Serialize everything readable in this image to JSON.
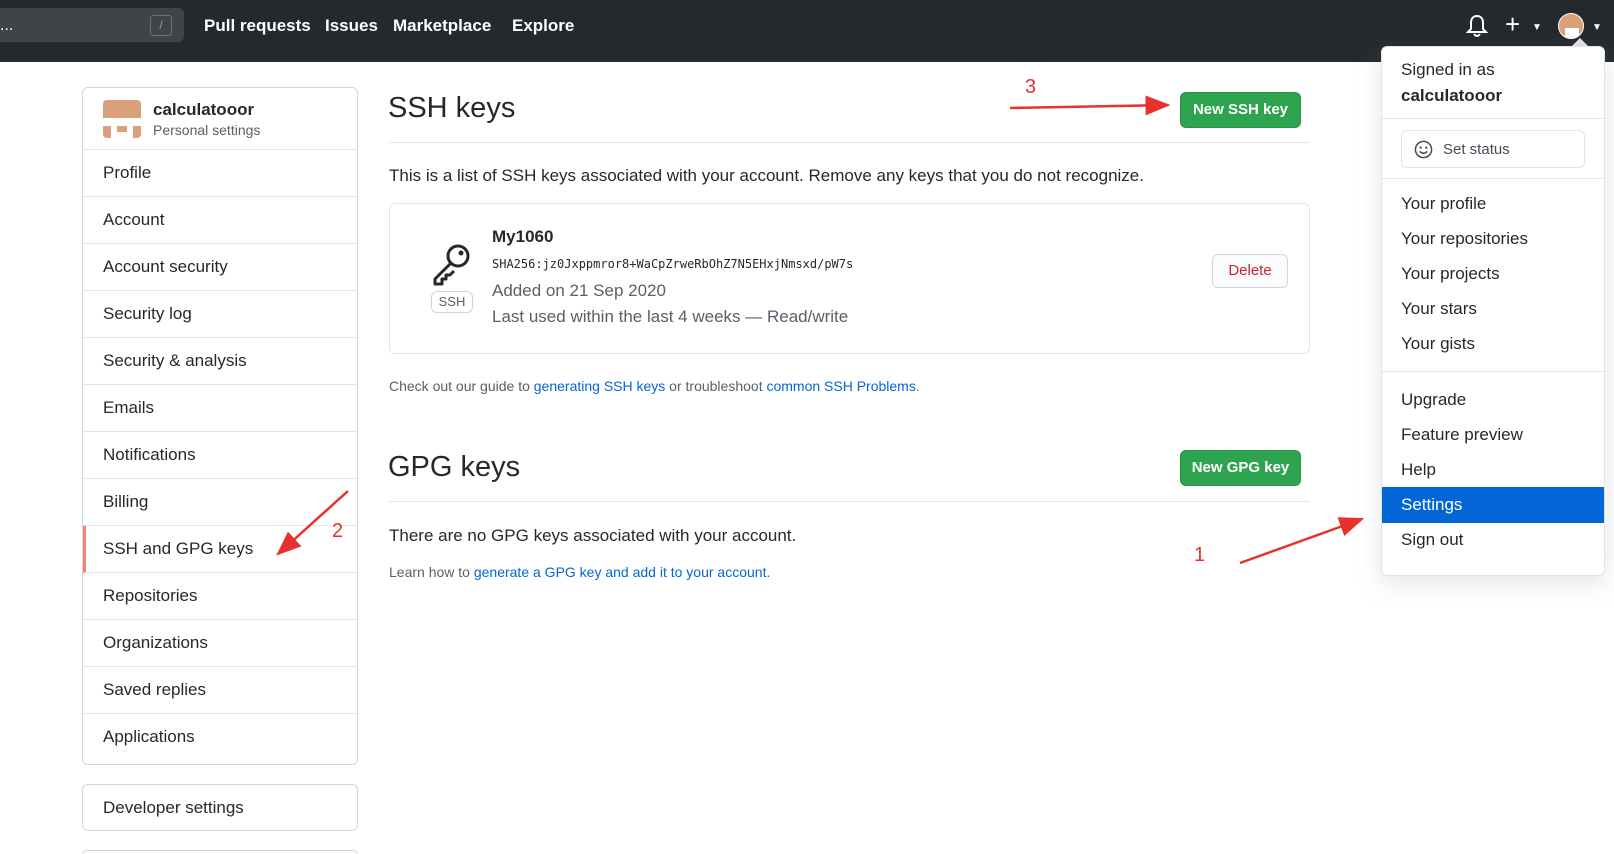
{
  "header": {
    "search_dots": "...",
    "search_shortcut": "/",
    "nav": [
      "Pull requests",
      "Issues",
      "Marketplace",
      "Explore"
    ],
    "plus": "+"
  },
  "sidebar": {
    "username": "calculatooor",
    "subtitle": "Personal settings",
    "items": [
      {
        "label": "Profile"
      },
      {
        "label": "Account"
      },
      {
        "label": "Account security"
      },
      {
        "label": "Security log"
      },
      {
        "label": "Security & analysis"
      },
      {
        "label": "Emails"
      },
      {
        "label": "Notifications"
      },
      {
        "label": "Billing"
      },
      {
        "label": "SSH and GPG keys",
        "active": true
      },
      {
        "label": "Repositories"
      },
      {
        "label": "Organizations"
      },
      {
        "label": "Saved replies"
      },
      {
        "label": "Applications"
      }
    ],
    "developer_settings": "Developer settings"
  },
  "ssh": {
    "title": "SSH keys",
    "new_button": "New SSH key",
    "description": "This is a list of SSH keys associated with your account. Remove any keys that you do not recognize.",
    "key": {
      "badge": "SSH",
      "name": "My1060",
      "fingerprint": "SHA256:jz0Jxppmror8+WaCpZrweRbOhZ7N5EHxjNmsxd/pW7s",
      "added": "Added on 21 Sep 2020",
      "last_used": "Last used within the last 4 weeks — Read/write",
      "delete_label": "Delete"
    },
    "guide_prefix": "Check out our guide to ",
    "guide_link1": "generating SSH keys",
    "guide_mid": " or troubleshoot ",
    "guide_link2": "common SSH Problems",
    "guide_suffix": "."
  },
  "gpg": {
    "title": "GPG keys",
    "new_button": "New GPG key",
    "empty": "There are no GPG keys associated with your account.",
    "learn_prefix": "Learn how to ",
    "learn_link": "generate a GPG key and add it to your account",
    "learn_suffix": "."
  },
  "dropdown": {
    "signed_in_as": "Signed in as",
    "username": "calculatooor",
    "set_status": "Set status",
    "group1": [
      "Your profile",
      "Your repositories",
      "Your projects",
      "Your stars",
      "Your gists"
    ],
    "group2": [
      "Upgrade",
      "Feature preview",
      "Help",
      "Settings",
      "Sign out"
    ],
    "active": "Settings"
  },
  "annotations": {
    "one": "1",
    "two": "2",
    "three": "3",
    "color": "#e8302e"
  },
  "colors": {
    "header": "#24292e",
    "green": "#2ea44f",
    "link": "#0366d6",
    "active_border": "#f9826c",
    "danger": "#cb2431"
  }
}
